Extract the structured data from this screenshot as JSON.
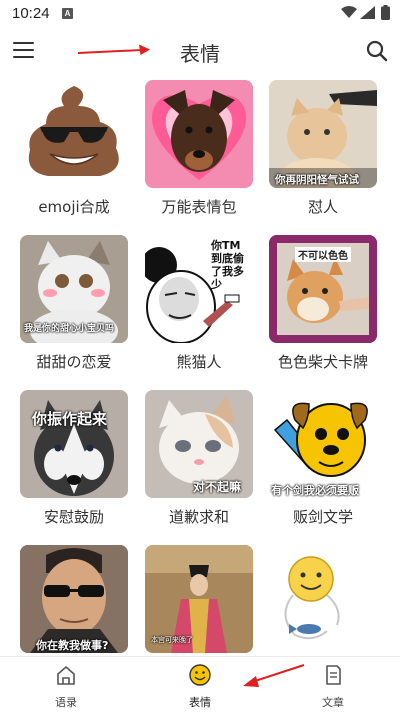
{
  "status_bar": {
    "time": "10:24",
    "sim_badge": "A"
  },
  "header": {
    "title": "表情"
  },
  "grid": {
    "items": [
      {
        "label": "emoji合成"
      },
      {
        "label": "万能表情包"
      },
      {
        "label": "怼人",
        "caption": "你再阴阳怪气试试"
      },
      {
        "label": "甜甜の恋爱",
        "caption": "我是你的甜心小宝贝吗"
      },
      {
        "label": "熊猫人",
        "caption": "你TM到底偷了我多少"
      },
      {
        "label": "色色柴犬卡牌",
        "caption": "不可以色色"
      },
      {
        "label": "安慰鼓励",
        "caption": "你振作起来"
      },
      {
        "label": "道歉求和",
        "caption": "对不起嘛"
      },
      {
        "label": "贩剑文学",
        "caption": "有个剑我必须要贩"
      },
      {
        "label": "",
        "caption": "你在教我做事?"
      },
      {
        "label": "",
        "caption": "本宫可来晚了"
      },
      {
        "label": ""
      }
    ]
  },
  "bottom_nav": {
    "items": [
      {
        "label": "语录",
        "icon": "home-icon",
        "active": false
      },
      {
        "label": "表情",
        "icon": "smiley-icon",
        "active": true
      },
      {
        "label": "文章",
        "icon": "document-icon",
        "active": false
      }
    ]
  },
  "colors": {
    "accent_yellow": "#f6c400",
    "annotation_red": "#e02020",
    "text_primary": "#333333",
    "nav_label": "#444444"
  }
}
